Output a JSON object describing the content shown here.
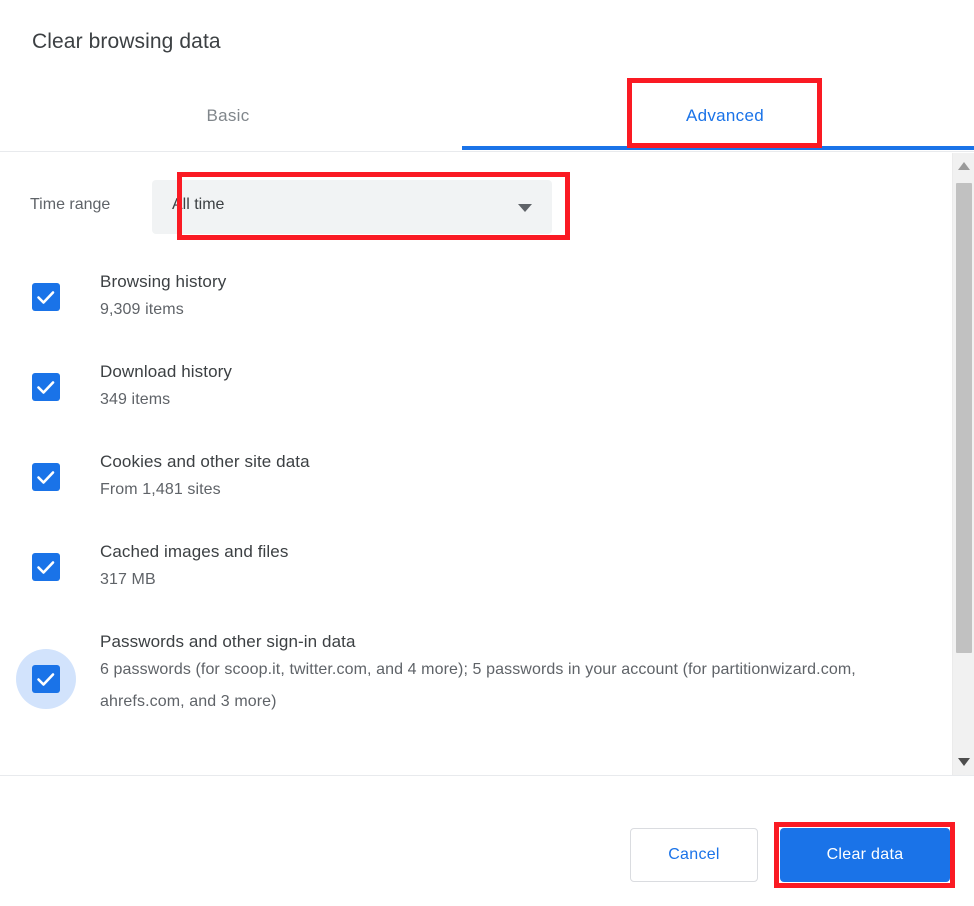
{
  "dialog": {
    "title": "Clear browsing data"
  },
  "tabs": [
    {
      "id": "basic",
      "label": "Basic",
      "selected": false
    },
    {
      "id": "advanced",
      "label": "Advanced",
      "selected": true
    }
  ],
  "time_range": {
    "label": "Time range",
    "selected": "All time",
    "icon": "chevron-down-icon"
  },
  "items": [
    {
      "label": "Browsing history",
      "sublabel": "9,309 items",
      "checked": true,
      "focused": false
    },
    {
      "label": "Download history",
      "sublabel": "349 items",
      "checked": true,
      "focused": false
    },
    {
      "label": "Cookies and other site data",
      "sublabel": "From 1,481 sites",
      "checked": true,
      "focused": false
    },
    {
      "label": "Cached images and files",
      "sublabel": "317 MB",
      "checked": true,
      "focused": false
    },
    {
      "label": "Passwords and other sign-in data",
      "sublabel": "6 passwords (for scoop.it, twitter.com, and 4 more); 5 passwords in your account (for partitionwizard.com, ahrefs.com, and 3 more)",
      "checked": true,
      "focused": true
    }
  ],
  "footer": {
    "cancel_label": "Cancel",
    "confirm_label": "Clear data"
  },
  "scrollbar": {
    "up_icon": "scroll-up-arrow-icon",
    "down_icon": "scroll-down-arrow-icon"
  },
  "colors": {
    "accent": "#1a73e8",
    "annotation": "#fa1a23",
    "text_primary": "#3c4043",
    "text_secondary": "#5f6368",
    "field_background": "#f1f3f4",
    "ripple": "#d2e3fc"
  }
}
